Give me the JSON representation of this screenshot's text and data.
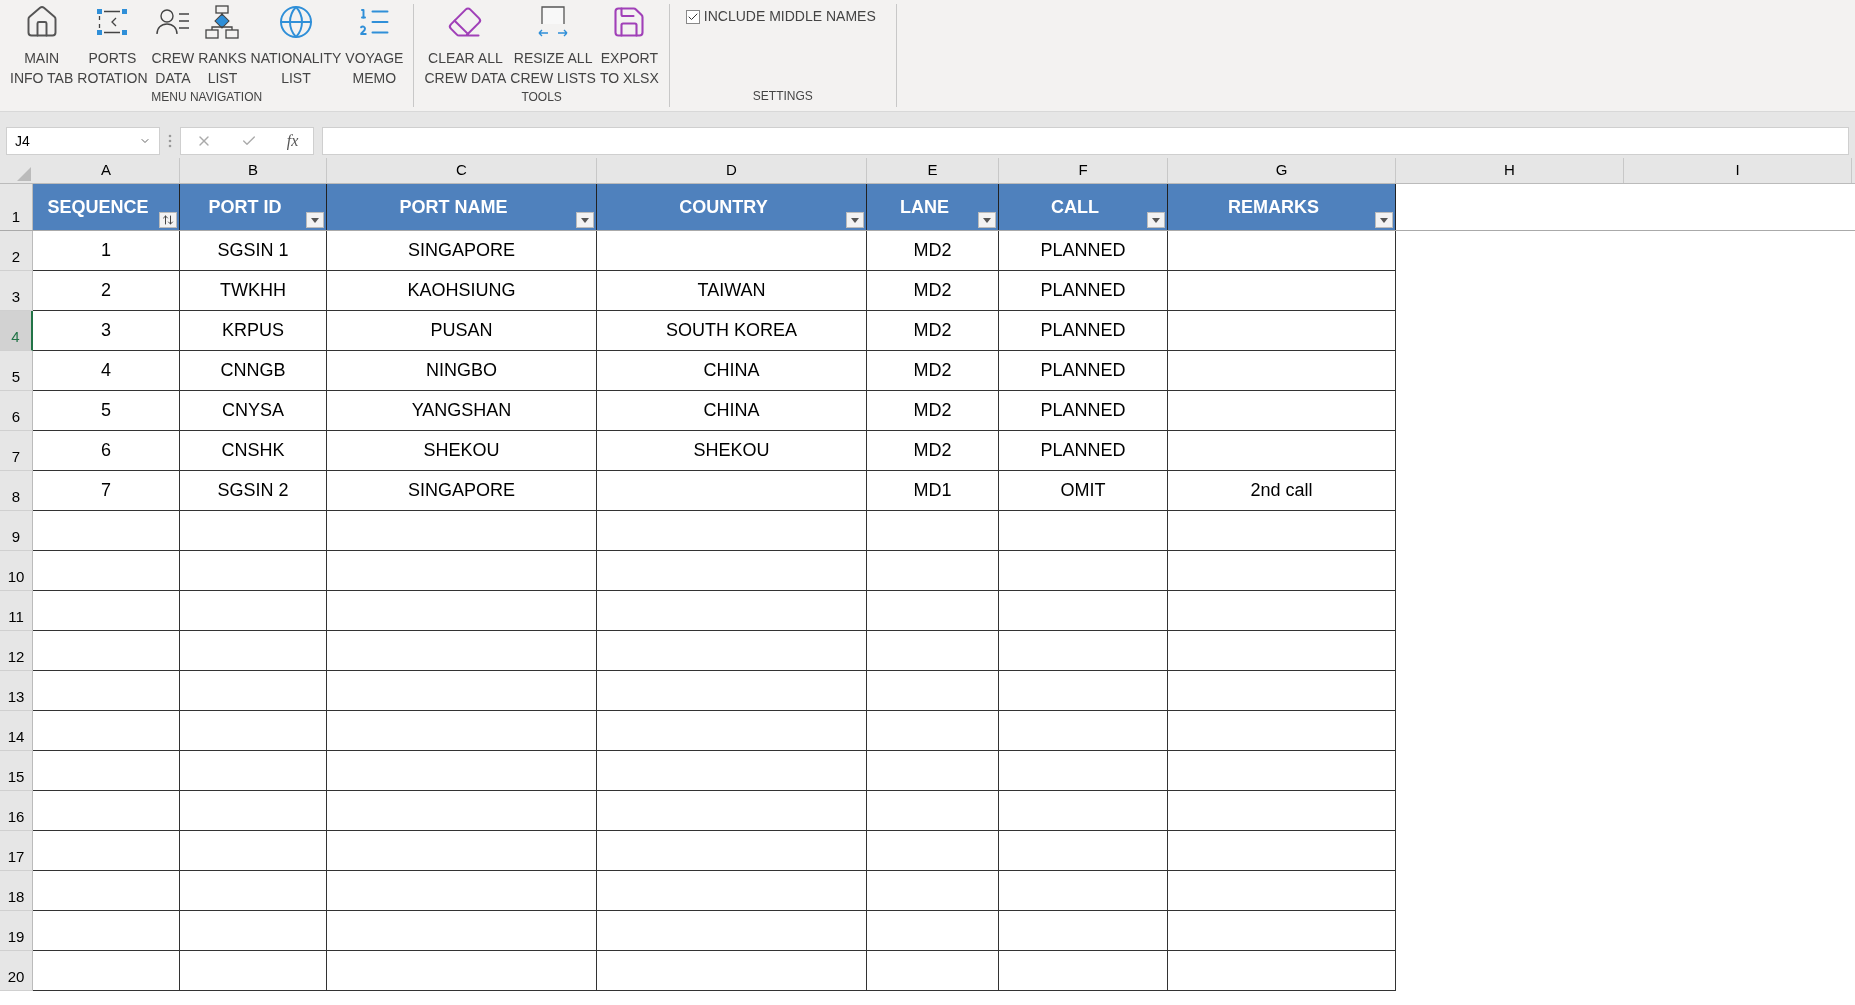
{
  "ribbon": {
    "groups": [
      {
        "label": "MENU NAVIGATION",
        "buttons": [
          {
            "kind": "home",
            "lines": [
              "MAIN",
              "INFO TAB"
            ]
          },
          {
            "kind": "diagram",
            "lines": [
              "PORTS",
              "ROTATION"
            ]
          },
          {
            "kind": "person",
            "lines": [
              "CREW",
              "DATA"
            ]
          },
          {
            "kind": "org",
            "lines": [
              "RANKS",
              "LIST"
            ]
          },
          {
            "kind": "globe",
            "lines": [
              "NATIONALITY",
              "LIST"
            ]
          },
          {
            "kind": "numbered",
            "lines": [
              "VOYAGE",
              "MEMO"
            ]
          }
        ]
      },
      {
        "label": "TOOLS",
        "buttons": [
          {
            "kind": "eraser",
            "lines": [
              "CLEAR ALL",
              "CREW DATA"
            ]
          },
          {
            "kind": "resize",
            "lines": [
              "RESIZE ALL",
              "CREW LISTS"
            ]
          },
          {
            "kind": "save",
            "lines": [
              "EXPORT",
              "TO XLSX"
            ]
          }
        ]
      },
      {
        "label": "SETTINGS",
        "checkbox": {
          "label": "INCLUDE MIDDLE NAMES",
          "checked": true
        }
      }
    ]
  },
  "formula_bar": {
    "name_box": "J4",
    "function_label": "fx"
  },
  "sheet": {
    "column_letters": [
      "A",
      "B",
      "C",
      "D",
      "E",
      "F",
      "G",
      "H",
      "I"
    ],
    "header_row": "1",
    "columns": [
      {
        "title": "SEQUENCE",
        "sorted": true
      },
      {
        "title": "PORT ID",
        "sorted": false
      },
      {
        "title": "PORT NAME",
        "sorted": false
      },
      {
        "title": "COUNTRY",
        "sorted": false
      },
      {
        "title": "LANE",
        "sorted": false
      },
      {
        "title": "CALL",
        "sorted": false
      },
      {
        "title": "REMARKS",
        "sorted": false
      }
    ],
    "rows": [
      {
        "row_number": "2",
        "selected": false,
        "cells": [
          "1",
          "SGSIN 1",
          "SINGAPORE",
          null,
          "MD2",
          "PLANNED",
          null
        ]
      },
      {
        "row_number": "3",
        "selected": false,
        "cells": [
          "2",
          "TWKHH",
          "KAOHSIUNG",
          "TAIWAN",
          "MD2",
          "PLANNED",
          null
        ]
      },
      {
        "row_number": "4",
        "selected": true,
        "cells": [
          "3",
          "KRPUS",
          "PUSAN",
          "SOUTH KOREA",
          "MD2",
          "PLANNED",
          null
        ]
      },
      {
        "row_number": "5",
        "selected": false,
        "cells": [
          "4",
          "CNNGB",
          "NINGBO",
          "CHINA",
          "MD2",
          "PLANNED",
          null
        ]
      },
      {
        "row_number": "6",
        "selected": false,
        "cells": [
          "5",
          "CNYSA",
          "YANGSHAN",
          "CHINA",
          "MD2",
          "PLANNED",
          null
        ]
      },
      {
        "row_number": "7",
        "selected": false,
        "cells": [
          "6",
          "CNSHK",
          "SHEKOU",
          "SHEKOU",
          "MD2",
          "PLANNED",
          null
        ]
      },
      {
        "row_number": "8",
        "selected": false,
        "cells": [
          "7",
          "SGSIN 2",
          "SINGAPORE",
          null,
          "MD1",
          "OMIT",
          "2nd call"
        ]
      },
      {
        "row_number": "9",
        "selected": false
      },
      {
        "row_number": "10",
        "selected": false
      },
      {
        "row_number": "11",
        "selected": false
      },
      {
        "row_number": "12",
        "selected": false
      },
      {
        "row_number": "13",
        "selected": false
      },
      {
        "row_number": "14",
        "selected": false
      },
      {
        "row_number": "15",
        "selected": false
      },
      {
        "row_number": "16",
        "selected": false
      },
      {
        "row_number": "17",
        "selected": false
      },
      {
        "row_number": "18",
        "selected": false
      },
      {
        "row_number": "19",
        "selected": false
      },
      {
        "row_number": "20",
        "selected": false
      }
    ]
  }
}
